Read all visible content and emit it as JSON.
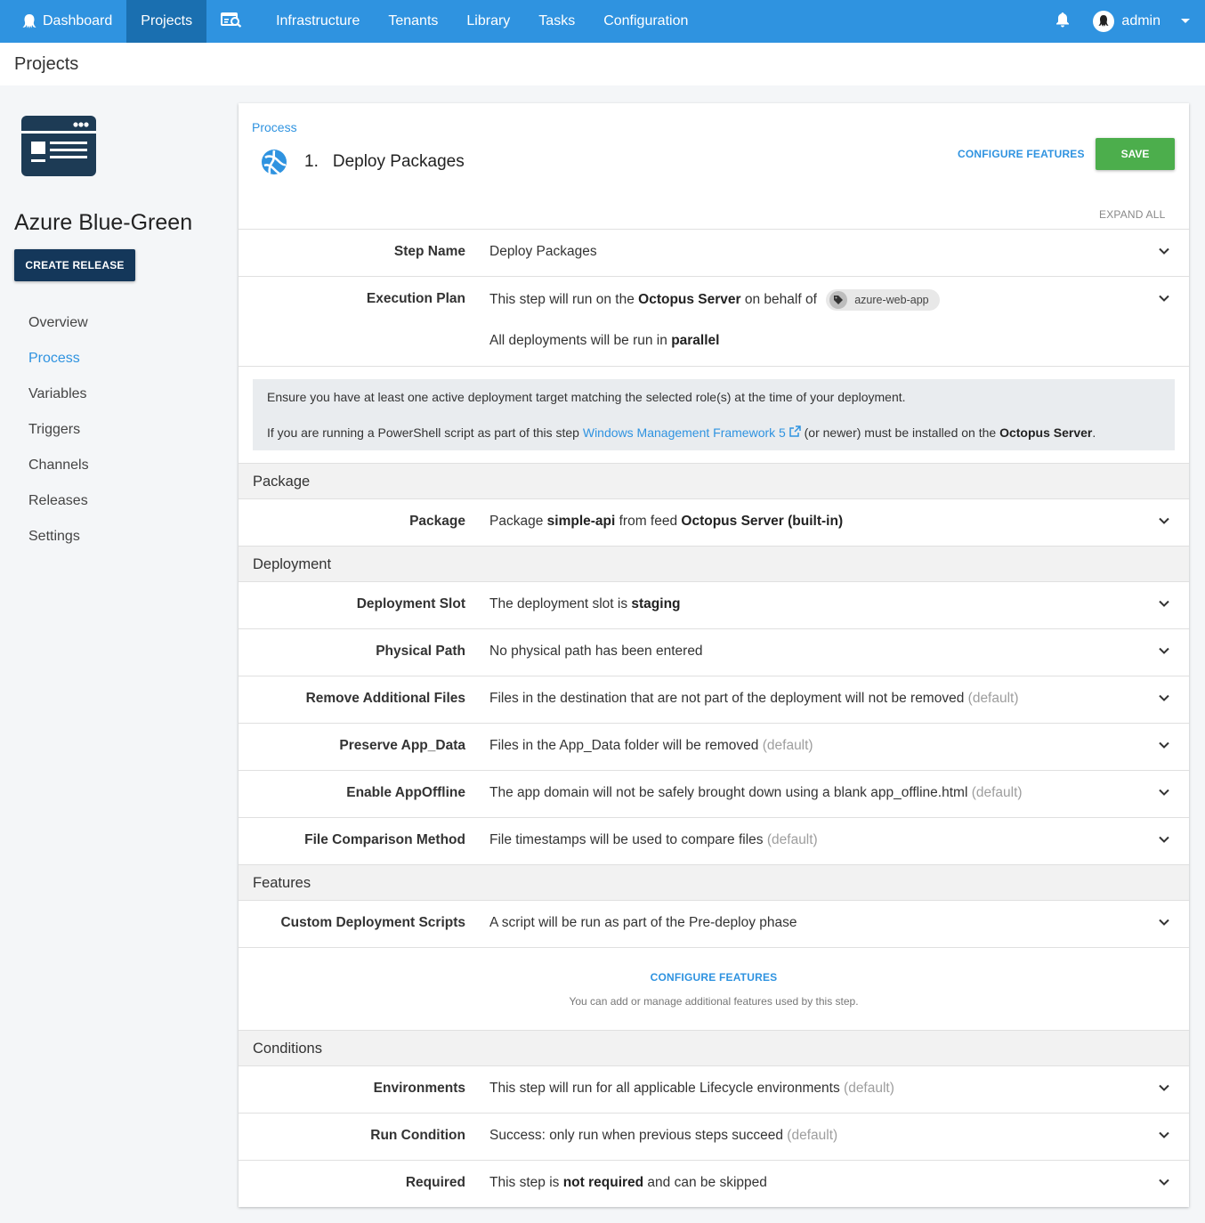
{
  "topnav": {
    "items": [
      {
        "label": "Dashboard",
        "icon": "octopus-icon",
        "active": false
      },
      {
        "label": "Projects",
        "active": true
      },
      {
        "label": "",
        "icon": "search-tasks-icon",
        "active": false
      },
      {
        "label": "Infrastructure",
        "active": false
      },
      {
        "label": "Tenants",
        "active": false
      },
      {
        "label": "Library",
        "active": false
      },
      {
        "label": "Tasks",
        "active": false
      },
      {
        "label": "Configuration",
        "active": false
      }
    ],
    "user": "admin",
    "accent": "#2f93e0",
    "active_bg": "#1a6fb0"
  },
  "page_header": "Projects",
  "sidebar": {
    "project_name": "Azure Blue-Green",
    "create_release": "CREATE RELEASE",
    "nav": [
      {
        "label": "Overview",
        "active": false
      },
      {
        "label": "Process",
        "active": true
      },
      {
        "label": "Variables",
        "active": false
      },
      {
        "label": "Triggers",
        "active": false
      },
      {
        "label": "Channels",
        "active": false
      },
      {
        "label": "Releases",
        "active": false
      },
      {
        "label": "Settings",
        "active": false
      }
    ]
  },
  "main": {
    "breadcrumb": "Process",
    "step_number": "1.",
    "step_title": "Deploy Packages",
    "configure_features": "CONFIGURE FEATURES",
    "save": "SAVE",
    "expand_all": "EXPAND ALL",
    "step_name": {
      "label": "Step Name",
      "value": "Deploy Packages"
    },
    "execution_plan": {
      "label": "Execution Plan",
      "line1_pre": "This step will run on the ",
      "line1_bold": "Octopus Server",
      "line1_post": " on behalf of",
      "role": "azure-web-app",
      "line2_pre": "All deployments will be run in ",
      "line2_bold": "parallel"
    },
    "callout": {
      "line1": "Ensure you have at least one active deployment target matching the selected role(s) at the time of your deployment.",
      "line2_pre": "If you are running a PowerShell script as part of this step ",
      "line2_link": "Windows Management Framework 5",
      "line2_mid": " (or newer) must be installed on the ",
      "line2_bold": "Octopus Server",
      "line2_end": "."
    },
    "sections": {
      "package": "Package",
      "deployment": "Deployment",
      "features": "Features",
      "conditions": "Conditions"
    },
    "package": {
      "label": "Package",
      "pre": "Package ",
      "name": "simple-api",
      "mid": " from feed ",
      "feed": "Octopus Server (built-in)"
    },
    "deployment_slot": {
      "label": "Deployment Slot",
      "pre": "The deployment slot is ",
      "bold": "staging"
    },
    "physical_path": {
      "label": "Physical Path",
      "value": "No physical path has been entered"
    },
    "remove_files": {
      "label": "Remove Additional Files",
      "value": "Files in the destination that are not part of the deployment will not be removed",
      "default": "(default)"
    },
    "preserve_app_data": {
      "label": "Preserve App_Data",
      "value": "Files in the App_Data folder will be removed",
      "default": "(default)"
    },
    "enable_appoffline": {
      "label": "Enable AppOffline",
      "value": "The app domain will not be safely brought down using a blank app_offline.html",
      "default": "(default)"
    },
    "file_comparison": {
      "label": "File Comparison Method",
      "value": "File timestamps will be used to compare files",
      "default": "(default)"
    },
    "custom_scripts": {
      "label": "Custom Deployment Scripts",
      "value": "A script will be run as part of the Pre-deploy phase"
    },
    "features_box": {
      "link": "CONFIGURE FEATURES",
      "hint": "You can add or manage additional features used by this step."
    },
    "environments": {
      "label": "Environments",
      "value": "This step will run for all applicable Lifecycle environments",
      "default": "(default)"
    },
    "run_condition": {
      "label": "Run Condition",
      "value": "Success: only run when previous steps succeed",
      "default": "(default)"
    },
    "required": {
      "label": "Required",
      "pre": "This step is ",
      "bold": "not required",
      "post": " and can be skipped"
    }
  }
}
